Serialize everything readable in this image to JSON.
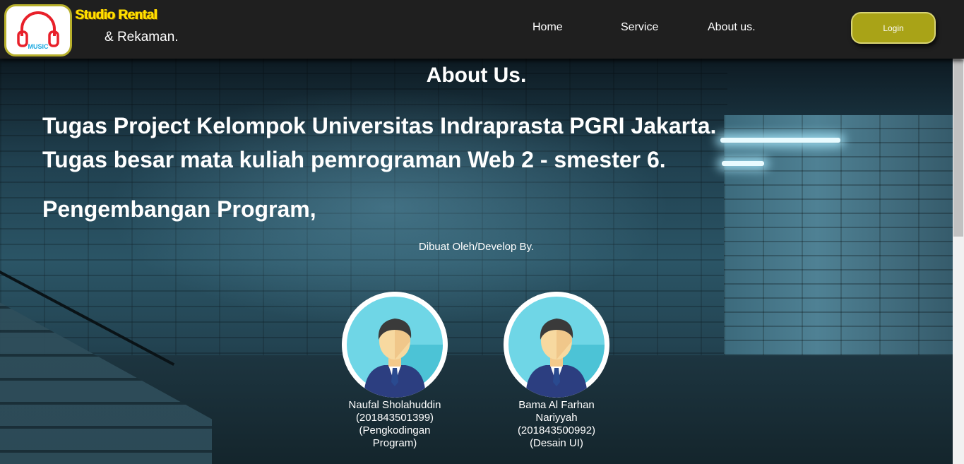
{
  "brand": {
    "title": "Studio Rental",
    "subtitle": "& Rekaman.",
    "logo_text": "MUSIC",
    "logo_icon": "headphones-icon"
  },
  "nav": {
    "items": [
      {
        "label": "Home"
      },
      {
        "label": "Service"
      },
      {
        "label": "About us."
      }
    ],
    "login_label": "Login"
  },
  "content": {
    "heading": "About Us.",
    "line1": "Tugas Project Kelompok Universitas Indraprasta PGRI Jakarta.",
    "line2": "Tugas besar mata kuliah pemrograman Web 2 - smester 6.",
    "line3": "Pengembangan Program,",
    "dev_by": "Dibuat Oleh/Develop By."
  },
  "developers": [
    {
      "name": "Naufal Sholahuddin",
      "id": "(201843501399)",
      "role": "(Pengkodingan Program)"
    },
    {
      "name": "Bama Al Farhan Nariyyah",
      "id": "(201843500992)",
      "role": "(Desain UI)"
    }
  ],
  "colors": {
    "navbar": "#1f1f1f",
    "accent": "#a9a317",
    "brand_title": "#ffe300",
    "avatar_bg": "#6fd6e6"
  }
}
